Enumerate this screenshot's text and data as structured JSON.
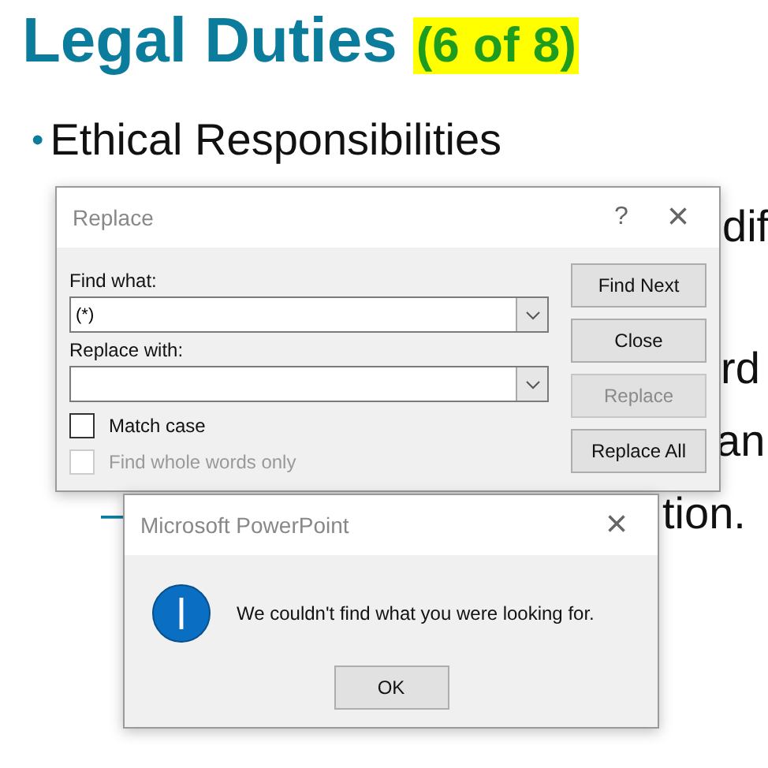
{
  "slide": {
    "title": "Legal Duties",
    "counter": "(6 of 8)",
    "bullet": "•",
    "heading": "Ethical Responsibilities",
    "fragments": [
      "dif",
      "rd",
      "an",
      "tion."
    ],
    "sub_dash": "–"
  },
  "replace_dialog": {
    "title": "Replace",
    "help": "?",
    "close": "×",
    "fields": [
      {
        "label": "Find what:",
        "value": "(*)"
      },
      {
        "label": "Replace with:"
      }
    ],
    "options": [
      {
        "label": "Match case",
        "checked": false,
        "disabled": false
      },
      {
        "label": "Find whole words only",
        "checked": false,
        "disabled": true
      }
    ],
    "buttons": [
      {
        "label": "Find Next",
        "disabled": false
      },
      {
        "label": "Close",
        "disabled": false
      },
      {
        "label": "Replace",
        "disabled": true
      },
      {
        "label": "Replace All",
        "disabled": false
      }
    ]
  },
  "message_box": {
    "title": "Microsoft PowerPoint",
    "close": "×",
    "message": "We couldn't find what you were looking for.",
    "button": "OK"
  }
}
